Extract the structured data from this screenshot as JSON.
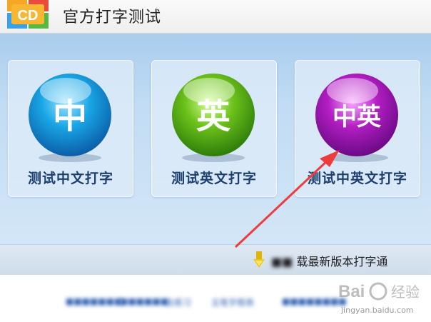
{
  "app": {
    "title": "官方打字测试",
    "logo_text": "CD"
  },
  "cards": [
    {
      "glyph": "中",
      "label": "测试中文打字",
      "color": "#1aa3e0"
    },
    {
      "glyph": "英",
      "label": "测试英文打字",
      "color": "#6cc21a"
    },
    {
      "glyph": "中英",
      "label": "测试中英文打字",
      "color": "#b41ec4"
    }
  ],
  "download": {
    "text": "载最新版本打字通"
  },
  "footer": {
    "links": [
      "",
      "",
      "去练习",
      "五笔字根表",
      ""
    ]
  },
  "watermark": {
    "text": "经验",
    "sub": "jingyan.baidu.com"
  }
}
